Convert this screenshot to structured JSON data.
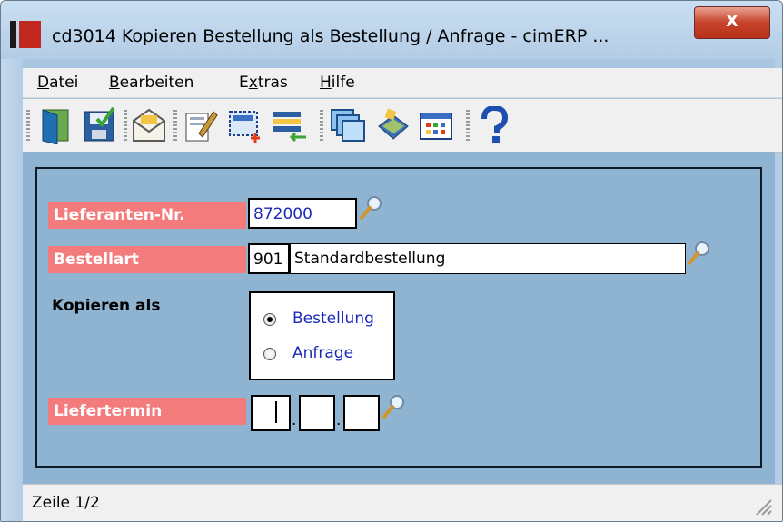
{
  "window": {
    "title": "cd3014 Kopieren Bestellung als Bestellung / Anfrage - cimERP ...",
    "close_label": "X"
  },
  "menu": [
    {
      "label": "Datei",
      "accel": "D"
    },
    {
      "label": "Bearbeiten",
      "accel": "B"
    },
    {
      "label": "Extras",
      "accel": "x"
    },
    {
      "label": "Hilfe",
      "accel": "H"
    }
  ],
  "toolbar": {
    "icons": [
      "exit-door-icon",
      "save-icon",
      "mail-icon",
      "edit-icon",
      "new-record-icon",
      "list-transfer-icon",
      "windows-icon",
      "book-icon",
      "calendar-icon",
      "help-icon"
    ]
  },
  "form": {
    "lieferant": {
      "label": "Lieferanten-Nr.",
      "value": "872000"
    },
    "bestellart": {
      "label": "Bestellart",
      "code": "901",
      "description": "Standardbestellung"
    },
    "kopieren": {
      "label": "Kopieren als",
      "options": [
        "Bestellung",
        "Anfrage"
      ],
      "selected": "Bestellung"
    },
    "liefertermin": {
      "label": "Liefertermin",
      "day": "",
      "month": "",
      "year": "",
      "sep1": ".",
      "sep2": "."
    }
  },
  "status": {
    "text": "Zeile 1/2"
  },
  "colors": {
    "label_bg": "#f47b7b",
    "panel_bg": "#8fb4d2",
    "radio_text": "#1b2ab8"
  }
}
